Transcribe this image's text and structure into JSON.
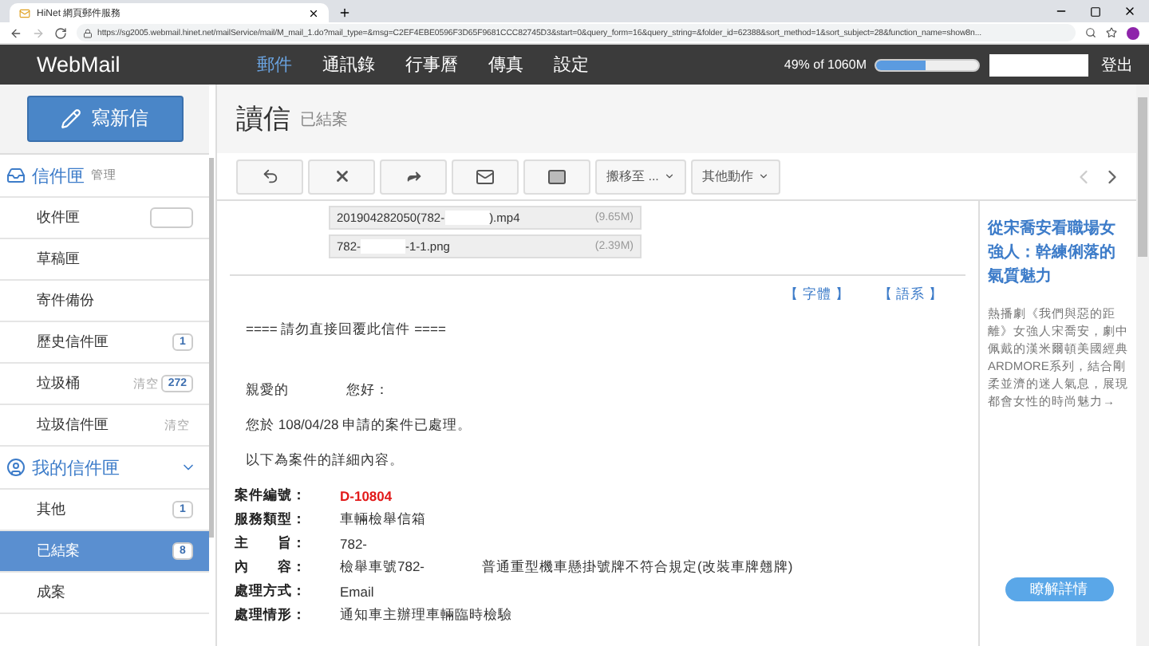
{
  "browser": {
    "tab_title": "HiNet 網頁郵件服務",
    "url": "https://sg2005.webmail.hinet.net/mailService/mail/M_mail_1.do?mail_type=&msg=C2EF4EBE0596F3D65F9681CCC82745D3&start=0&query_form=16&query_string=&folder_id=62388&sort_method=1&sort_subject=28&function_name=show8n..."
  },
  "navbar": {
    "brand": "WebMail",
    "tabs": [
      {
        "label": "郵件",
        "selected": true
      },
      {
        "label": "通訊錄",
        "selected": false
      },
      {
        "label": "行事曆",
        "selected": false
      },
      {
        "label": "傳真",
        "selected": false
      },
      {
        "label": "設定",
        "selected": false
      }
    ],
    "quota": {
      "text": "49% of 1060M",
      "level": 0.49
    },
    "logout": "登出"
  },
  "sidebar": {
    "compose": "寫新信",
    "groups": [
      {
        "title": "信件匣",
        "action": "管理",
        "items": [
          {
            "label": "收件匣",
            "selected": false,
            "empty_badge": true
          },
          {
            "label": "草稿匣",
            "selected": false
          },
          {
            "label": "寄件備份",
            "selected": false
          },
          {
            "label": "歷史信件匣",
            "selected": false,
            "badge": "1"
          },
          {
            "label": "垃圾桶",
            "selected": false,
            "action": "清空",
            "badge": "272"
          },
          {
            "label": "垃圾信件匣",
            "selected": false,
            "action": "清空"
          }
        ]
      },
      {
        "title": "我的信件匣",
        "expanded": true,
        "items": [
          {
            "label": "其他",
            "selected": false,
            "badge": "1"
          },
          {
            "label": "已結案",
            "selected": true,
            "badge": "8"
          },
          {
            "label": "成案",
            "selected": false
          }
        ]
      }
    ]
  },
  "header": {
    "title": "讀信",
    "folder": "已結案"
  },
  "toolbar": {
    "move": "搬移至 ...",
    "more": "其他動作"
  },
  "attachments": [
    {
      "name_parts": [
        "201904282050(782-",
        ").mp4"
      ],
      "size": "(9.65M)"
    },
    {
      "name_parts": [
        "782-",
        "-1-1.png"
      ],
      "size": "(2.39M)"
    }
  ],
  "links": [
    "【 字體 】",
    "【 語系 】"
  ],
  "notice": "==== 請勿直接回覆此信件 ====",
  "body_lines": [
    {
      "parts": [
        "親愛的",
        "您好："
      ]
    },
    {
      "parts": [
        "您於 108/04/28 申請的案件已處理。"
      ]
    },
    {
      "parts": [
        "以下為案件的詳細內容。"
      ]
    }
  ],
  "details": [
    {
      "label": "案件編號：",
      "parts": [
        "D-10804"
      ],
      "highlight": true
    },
    {
      "label": "服務類型：",
      "parts": [
        "車輛檢舉信箱"
      ],
      "highlight": false
    },
    {
      "label": "主　　旨：",
      "parts": [
        "782-"
      ],
      "highlight": false
    },
    {
      "label": "內　　容：",
      "parts": [
        "檢舉車號782-",
        "普通重型機車懸掛號牌不符合規定(改裝車牌翹牌)"
      ],
      "highlight": false
    },
    {
      "label": "處理方式：",
      "parts": [
        "Email"
      ],
      "highlight": false
    },
    {
      "label": "處理情形：",
      "parts": [
        "通知車主辦理車輛臨時檢驗"
      ],
      "highlight": false
    }
  ],
  "ad": {
    "title": "從宋喬安看職場女強人：幹練俐落的氣質魅力",
    "text": "熱播劇《我們與惡的距離》女強人宋喬安，劇中佩戴的漢米爾頓美國經典ARDMORE系列，結合剛柔並濟的迷人氣息，展現都會女性的時尚魅力→",
    "button": "瞭解詳情"
  }
}
